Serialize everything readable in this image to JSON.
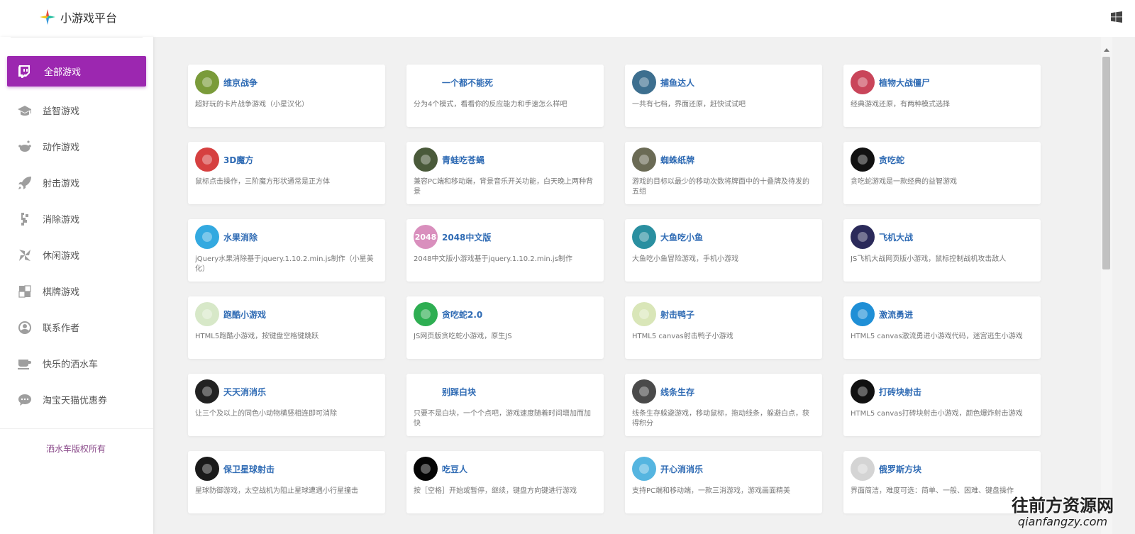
{
  "app": {
    "title": "小游戏平台"
  },
  "colors": {
    "accent": "#9c27b0",
    "title_link": "#2f6bb4"
  },
  "sidebar": {
    "items": [
      {
        "label": "全部游戏",
        "icon": "twitch-icon",
        "active": true
      },
      {
        "label": "益智游戏",
        "icon": "graduation-cap-icon"
      },
      {
        "label": "动作游戏",
        "icon": "reddit-icon"
      },
      {
        "label": "射击游戏",
        "icon": "rocket-icon"
      },
      {
        "label": "消除游戏",
        "icon": "shuffle-icon"
      },
      {
        "label": "休闲游戏",
        "icon": "pinwheel-icon"
      },
      {
        "label": "棋牌游戏",
        "icon": "checker-icon"
      },
      {
        "label": "联系作者",
        "icon": "user-icon"
      },
      {
        "label": "快乐的洒水车",
        "icon": "coffee-icon"
      },
      {
        "label": "淘宝天猫优惠券",
        "icon": "chat-bubble-icon"
      }
    ],
    "copyright": "洒水车版权所有"
  },
  "games": [
    {
      "title": "维京战争",
      "desc": "超好玩的卡片战争游戏（小星汉化）",
      "icon": "viking-icon",
      "bg": "#7a9b3a"
    },
    {
      "title": "一个都不能死",
      "desc": "分为4个模式，看看你的反应能力和手速怎么样吧",
      "icon": "runner-icon",
      "bg": "#ffffff"
    },
    {
      "title": "捕鱼达人",
      "desc": "一共有七档，界面还原，赶快试试吧",
      "icon": "fish-icon",
      "bg": "#3d6f8f"
    },
    {
      "title": "植物大战僵尸",
      "desc": "经典游戏还原，有两种模式选择",
      "icon": "pvz-icon",
      "bg": "#c9455a"
    },
    {
      "title": "3D魔方",
      "desc": "鼠标点击操作，三阶魔方形状通常是正方体",
      "icon": "cube-icon",
      "bg": "#d64040"
    },
    {
      "title": "青蛙吃苍蝇",
      "desc": "兼容PC端和移动端，背景音乐开关功能，白天晚上两种背景",
      "icon": "frog-icon",
      "bg": "#4a5a3a"
    },
    {
      "title": "蜘蛛纸牌",
      "desc": "游戏的目标以最少的移动次数将牌面中的十叠牌及待发的五组",
      "icon": "cards-icon",
      "bg": "#6b6b55"
    },
    {
      "title": "贪吃蛇",
      "desc": "贪吃蛇游戏是一款经典的益智游戏",
      "icon": "snake-icon",
      "bg": "#111111"
    },
    {
      "title": "水果消除",
      "desc": "jQuery水果消除基于jquery.1.10.2.min.js制作（小星美化）",
      "icon": "fruit-icon",
      "bg": "#33a9e0"
    },
    {
      "title": "2048中文版",
      "desc": "2048中文版小游戏基于jquery.1.10.2.min.js制作",
      "icon": "2048-icon",
      "bg": "#d98fbd",
      "badge": "2048"
    },
    {
      "title": "大鱼吃小鱼",
      "desc": "大鱼吃小鱼冒险游戏，手机小游戏",
      "icon": "bigfish-icon",
      "bg": "#2a8fa0"
    },
    {
      "title": "飞机大战",
      "desc": "JS飞机大战网页版小游戏，鼠标控制战机攻击敌人",
      "icon": "plane-icon",
      "bg": "#2b2a5a"
    },
    {
      "title": "跑酷小游戏",
      "desc": "HTML5跑酷小游戏，按键盘空格键跳跃",
      "icon": "parkour-icon",
      "bg": "#d7e8c8"
    },
    {
      "title": "贪吃蛇2.0",
      "desc": "JS网页版贪吃蛇小游戏，原生JS",
      "icon": "snake2-icon",
      "bg": "#2eae52"
    },
    {
      "title": "射击鸭子",
      "desc": "HTML5 canvas射击鸭子小游戏",
      "icon": "duck-icon",
      "bg": "#d9e6b8"
    },
    {
      "title": "激流勇进",
      "desc": "HTML5 canvas激流勇进小游戏代码，迷宫逃生小游戏",
      "icon": "rapids-icon",
      "bg": "#1f8fd6"
    },
    {
      "title": "天天消消乐",
      "desc": "让三个及以上的同色小动物横竖相连即可消除",
      "icon": "match3-icon",
      "bg": "#222222"
    },
    {
      "title": "别踩白块",
      "desc": "只要不是白块，一个个点吧，游戏速度随着时间增加而加快",
      "icon": "piano-icon",
      "bg": "#ffffff"
    },
    {
      "title": "线条生存",
      "desc": "线条生存躲避游戏，移动鼠标，拖动线条，躲避白点，获得积分",
      "icon": "line-icon",
      "bg": "#4a4a4a"
    },
    {
      "title": "打砖块射击",
      "desc": "HTML5 canvas打砖块射击小游戏，颜色爆炸射击游戏",
      "icon": "brick-icon",
      "bg": "#111111"
    },
    {
      "title": "保卫星球射击",
      "desc": "星球防御游戏，太空战机为阻止星球遭遇小行星撞击",
      "icon": "planet-icon",
      "bg": "#1a1a1a"
    },
    {
      "title": "吃豆人",
      "desc": "按［空格］开始或暂停，继续，键盘方向键进行游戏",
      "icon": "pacman-icon",
      "bg": "#050505"
    },
    {
      "title": "开心消消乐",
      "desc": "支持PC端和移动端，一款三消游戏，游戏画面精美",
      "icon": "happy-match-icon",
      "bg": "#55b5e0"
    },
    {
      "title": "俄罗斯方块",
      "desc": "界面简洁，难度可选：简单、一般、困难、键盘操作",
      "icon": "tetris-icon",
      "bg": "#d4d4d4"
    }
  ],
  "watermark": {
    "main": "往前方资源网",
    "sub": "qianfangzy.com"
  }
}
